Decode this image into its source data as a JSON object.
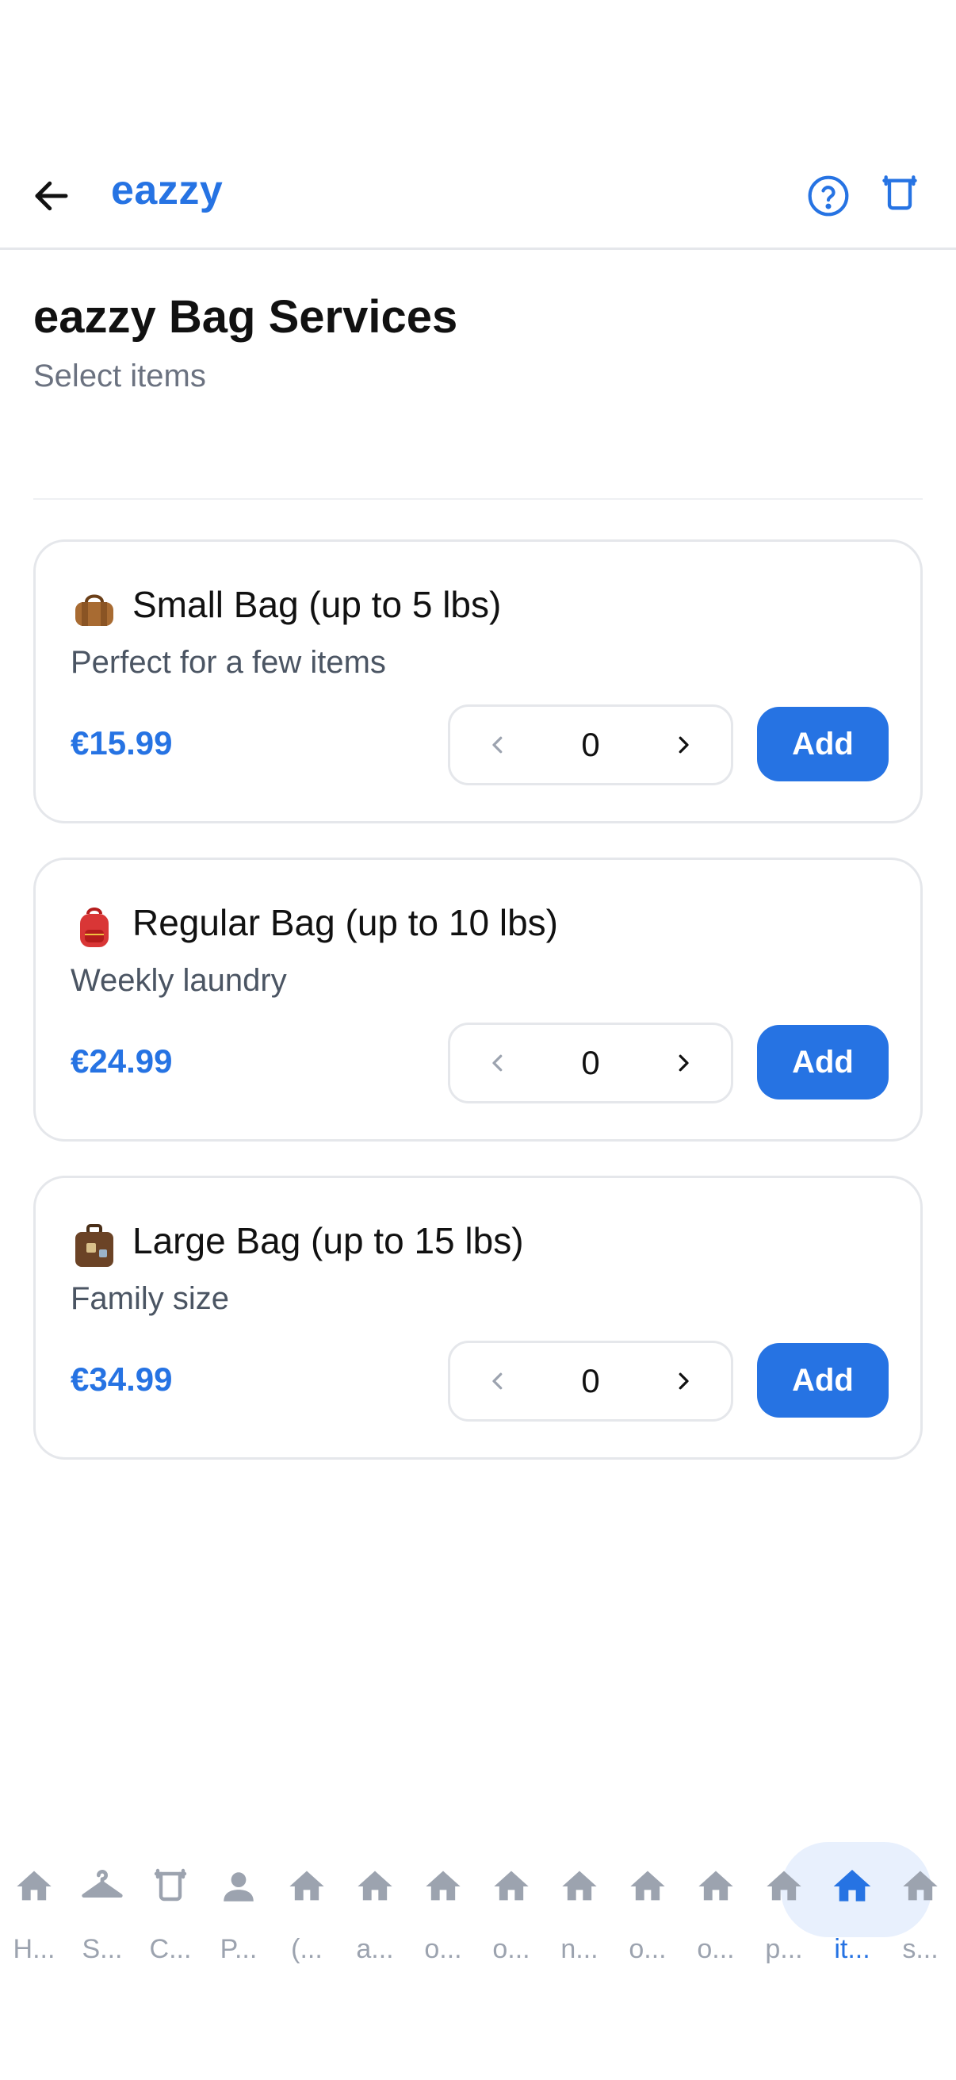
{
  "header": {
    "brand": "eazzy",
    "back_icon": "arrow-left-icon",
    "help_icon": "help-circle-icon",
    "basket_icon": "basket-icon"
  },
  "page": {
    "title": "eazzy Bag Services",
    "subtitle": "Select items"
  },
  "items": [
    {
      "emoji_icon": "duffel-bag-icon",
      "title": "Small Bag (up to 5 lbs)",
      "description": "Perfect for a few items",
      "price": "€15.99",
      "quantity": "0",
      "add_label": "Add"
    },
    {
      "emoji_icon": "backpack-icon",
      "title": "Regular Bag (up to 10 lbs)",
      "description": "Weekly laundry",
      "price": "€24.99",
      "quantity": "0",
      "add_label": "Add"
    },
    {
      "emoji_icon": "suitcase-icon",
      "title": "Large Bag (up to 15 lbs)",
      "description": "Family size",
      "price": "€34.99",
      "quantity": "0",
      "add_label": "Add"
    }
  ],
  "nav": {
    "items": [
      {
        "label": "H...",
        "icon": "home-icon"
      },
      {
        "label": "S...",
        "icon": "hanger-icon"
      },
      {
        "label": "C...",
        "icon": "basket-icon"
      },
      {
        "label": "P...",
        "icon": "person-icon"
      },
      {
        "label": "(...",
        "icon": "home-icon"
      },
      {
        "label": "a...",
        "icon": "home-icon"
      },
      {
        "label": "o...",
        "icon": "home-icon"
      },
      {
        "label": "o...",
        "icon": "home-icon"
      },
      {
        "label": "n...",
        "icon": "home-icon"
      },
      {
        "label": "o...",
        "icon": "home-icon"
      },
      {
        "label": "o...",
        "icon": "home-icon"
      },
      {
        "label": "p...",
        "icon": "home-icon"
      },
      {
        "label": "it...",
        "icon": "home-icon",
        "active": true
      },
      {
        "label": "s...",
        "icon": "home-icon"
      }
    ]
  },
  "colors": {
    "accent": "#2673e3",
    "muted": "#9ca3af",
    "border": "#e5e7eb"
  }
}
